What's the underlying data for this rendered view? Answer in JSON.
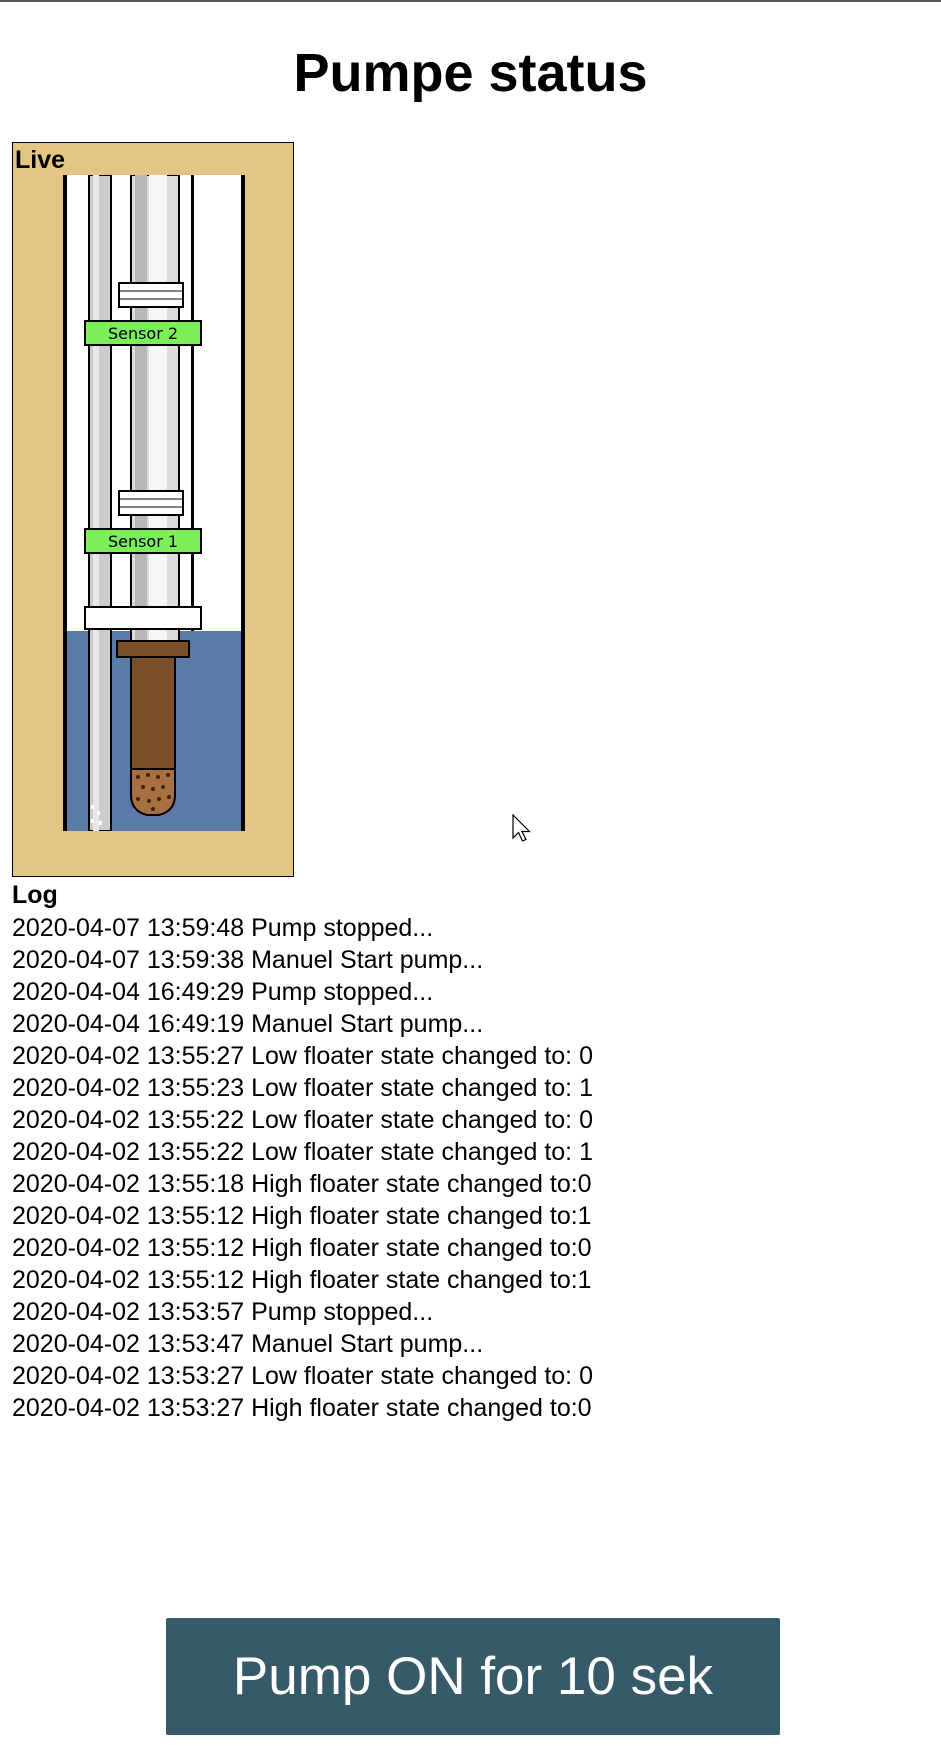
{
  "page": {
    "title": "Pumpe status"
  },
  "live": {
    "label": "Live",
    "sensors": {
      "sensor2": "Sensor 2",
      "sensor1": "Sensor 1"
    },
    "colors": {
      "panel": "#e3c684",
      "water": "#5b7aa8",
      "sensor_active": "#7cf05a",
      "pump_body": "#7c5026"
    }
  },
  "log": {
    "title": "Log",
    "entries": [
      "2020-04-07 13:59:48 Pump stopped...",
      "2020-04-07 13:59:38 Manuel Start pump...",
      "2020-04-04 16:49:29 Pump stopped...",
      "2020-04-04 16:49:19 Manuel Start pump...",
      "2020-04-02 13:55:27 Low floater state changed to: 0",
      "2020-04-02 13:55:23 Low floater state changed to: 1",
      "2020-04-02 13:55:22 Low floater state changed to: 0",
      "2020-04-02 13:55:22 Low floater state changed to: 1",
      "2020-04-02 13:55:18 High floater state changed to:0",
      "2020-04-02 13:55:12 High floater state changed to:1",
      "2020-04-02 13:55:12 High floater state changed to:0",
      "2020-04-02 13:55:12 High floater state changed to:1",
      "2020-04-02 13:53:57 Pump stopped...",
      "2020-04-02 13:53:47 Manuel Start pump...",
      "2020-04-02 13:53:27 Low floater state changed to: 0",
      "2020-04-02 13:53:27 High floater state changed to:0"
    ]
  },
  "actions": {
    "pump_button_label": "Pump ON for 10 sek",
    "pump_button_color": "#375a68"
  },
  "icons": {
    "cursor": "mouse-pointer-icon"
  }
}
